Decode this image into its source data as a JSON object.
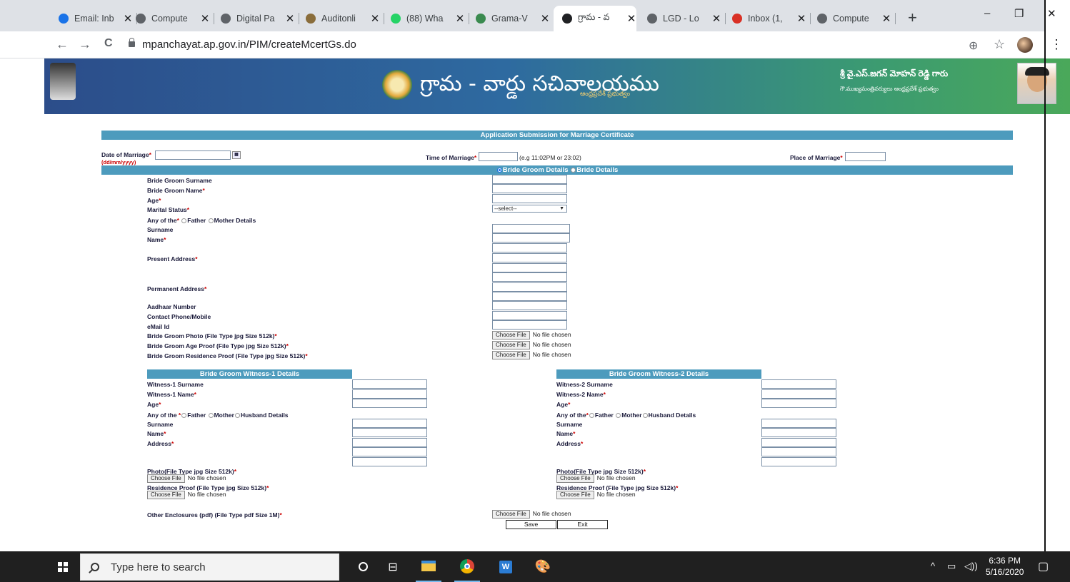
{
  "browser": {
    "tabs": [
      {
        "title": "Email: Inb",
        "favicon": "email-icon",
        "color": "#1a73e8"
      },
      {
        "title": "Compute",
        "favicon": "globe-icon",
        "color": "#5f6368"
      },
      {
        "title": "Digital Pa",
        "favicon": "globe-icon",
        "color": "#5f6368"
      },
      {
        "title": "Auditonli",
        "favicon": "emblem-icon",
        "color": "#8a6d3b"
      },
      {
        "title": "(88) Wha",
        "favicon": "whatsapp-icon",
        "color": "#25d366"
      },
      {
        "title": "Grama-V",
        "favicon": "emblem-icon",
        "color": "#3a8a4f"
      },
      {
        "title": "గ్రామ - వ",
        "favicon": "globe-icon",
        "color": "#202124"
      },
      {
        "title": "LGD - Lo",
        "favicon": "globe-icon",
        "color": "#5f6368"
      },
      {
        "title": "Inbox (1,",
        "favicon": "gmail-icon",
        "color": "#d93025"
      },
      {
        "title": "Compute",
        "favicon": "globe-icon",
        "color": "#5f6368"
      }
    ],
    "active_tab_index": 6,
    "new_tab": "+",
    "minimize": "–",
    "restore": "❐",
    "close": "✕",
    "url": "mpanchayat.ap.gov.in/PIM/createMcertGs.do",
    "back": "←",
    "forward": "→",
    "reload": "C",
    "zoom_icon": "⊕",
    "star": "☆",
    "menu": "⋮"
  },
  "banner": {
    "title": "గ్రామ - వార్డు సచివాలయము",
    "subtitle": "ఆంధ్రప్రదేశ్ ప్రభుత్వం",
    "cm_name": "శ్రీ వై.ఎస్.జగన్ మోహన్ రెడ్డి గారు",
    "cm_subtitle": "గౌ.ముఖ్యమంత్రివర్యులు ఆంధ్రప్రదేశ్ ప్రభుత్వం"
  },
  "form": {
    "heading": "Application Submission for Marriage Certificate",
    "date_label": "Date of Marriage",
    "date_hint": "(dd/mm/yyyy)",
    "time_label": "Time of Marriage",
    "time_hint": "(e.g 11:02PM or 23:02)",
    "place_label": "Place of Marriage",
    "toggle_groom": "Bride Groom Details",
    "toggle_bride": "Bride Details",
    "groom_surname": "Bride Groom  Surname",
    "groom_name": "Bride Groom  Name",
    "age": "Age",
    "marital_status": "Marital Status",
    "select_placeholder": "--select--",
    "any_of_the": "Any of the",
    "father": "Father",
    "mother": "Mother Details",
    "surname": "Surname",
    "name": "Name",
    "present_address": "Present Address",
    "permanent_address": "Permanent Address",
    "aadhaar": "Aadhaar Number",
    "contact": "Contact Phone/Mobile",
    "email": "eMail Id",
    "groom_photo": "Bride Groom  Photo (File Type jpg Size 512k)",
    "groom_age_proof": "Bride Groom  Age Proof (File Type jpg Size 512k)",
    "groom_res_proof": "Bride Groom  Residence Proof (File Type jpg Size 512k)",
    "choose_file": "Choose File",
    "no_file": "No file chosen",
    "w1_header": "Bride Groom Witness-1 Details",
    "w2_header": "Bride Groom Witness-2 Details",
    "w1_surname": "Witness-1  Surname",
    "w1_name": "Witness-1  Name",
    "w2_surname": "Witness-2  Surname",
    "w2_name": "Witness-2  Name",
    "w_any": "Any of the ",
    "w_father": "Father",
    "w_mother": "Mother",
    "w_husband": "Husband Details",
    "address": "Address",
    "w_photo": "Photo(File Type jpg Size 512k)",
    "w_res_proof": "Residence Proof (File Type jpg Size 512k)",
    "other_enclosures": "Other Enclosures  (pdf)  (File Type pdf Size 1M)",
    "save": "Save",
    "exit": "Exit"
  },
  "taskbar": {
    "search_placeholder": "Type here to search",
    "time": "6:36 PM",
    "date": "5/16/2020"
  }
}
